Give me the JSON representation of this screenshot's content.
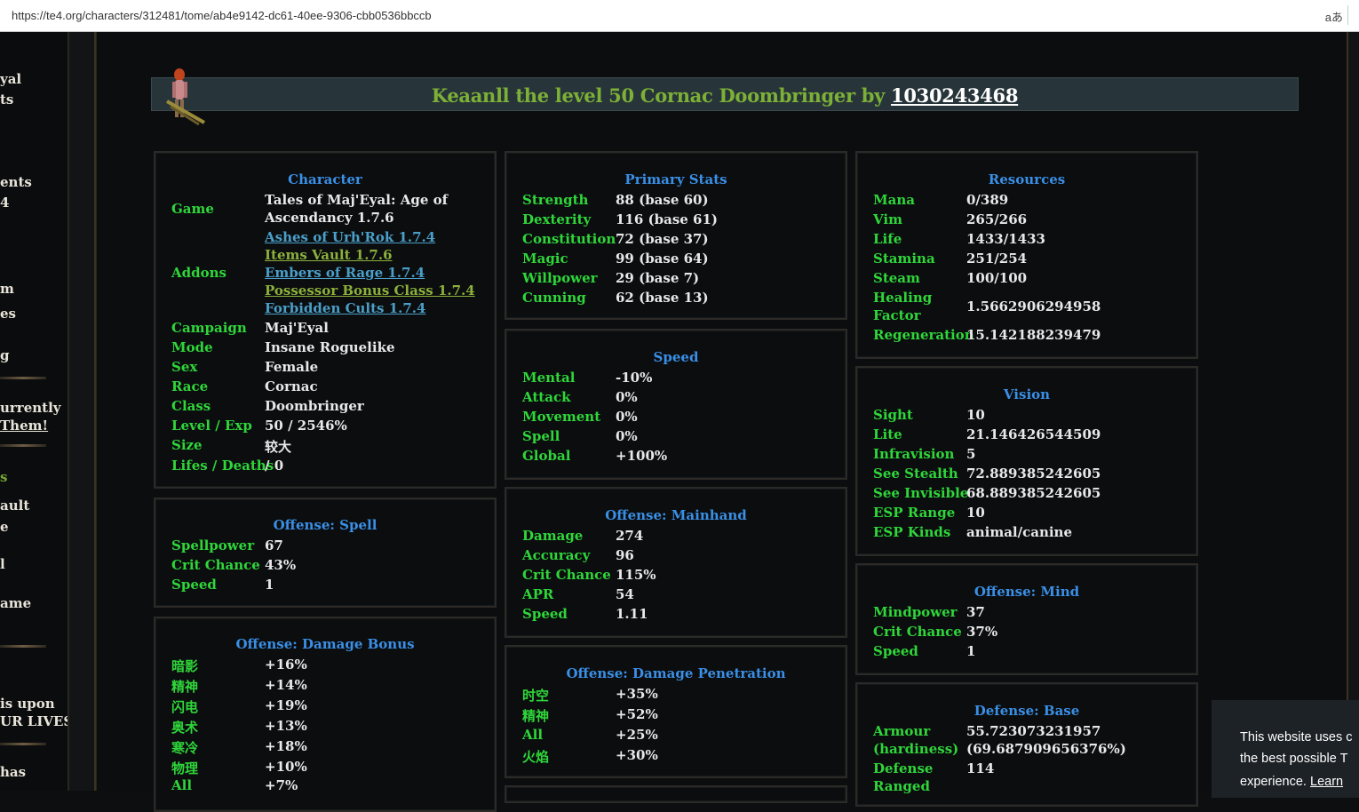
{
  "browser": {
    "url": "https://te4.org/characters/312481/tome/ab4e9142-dc61-40ee-9306-cbb0536bbccb",
    "aa_icon": "aあ"
  },
  "leftnav": {
    "fragments": [
      "yal",
      "ts",
      "ents",
      "4",
      "m",
      "es",
      "g",
      "urrently",
      "Them!",
      "s",
      "ault",
      "e",
      "l",
      "ame",
      "is upon",
      "UR LIVES!",
      "has"
    ]
  },
  "header": {
    "prefix": "Keaanll the level 50 Cornac Doombringer by ",
    "user": "1030243468"
  },
  "character": {
    "title": "Character",
    "game_label": "Game",
    "game_line1": "Tales of Maj'Eyal: Age of",
    "game_line2": "Ascendancy 1.7.6",
    "addons_label": "Addons",
    "addons": [
      "Ashes of Urh'Rok 1.7.4",
      "Items Vault 1.7.6",
      "Embers of Rage 1.7.4",
      "Possessor Bonus Class 1.7.4",
      "Forbidden Cults 1.7.4"
    ],
    "rows": [
      {
        "label": "Campaign",
        "value": "Maj'Eyal"
      },
      {
        "label": "Mode",
        "value": "Insane Roguelike"
      },
      {
        "label": "Sex",
        "value": "Female"
      },
      {
        "label": "Race",
        "value": "Cornac"
      },
      {
        "label": "Class",
        "value": "Doombringer"
      },
      {
        "label": "Level / Exp",
        "value": "50 / 2546%"
      },
      {
        "label": "Size",
        "value": "较大"
      },
      {
        "label": "Lifes / Deaths",
        "value": "/ 0"
      }
    ]
  },
  "offense_spell": {
    "title": "Offense: Spell",
    "rows": [
      {
        "label": "Spellpower",
        "value": "67"
      },
      {
        "label": "Crit Chance",
        "value": "43%"
      },
      {
        "label": "Speed",
        "value": "1"
      }
    ]
  },
  "damage_bonus": {
    "title": "Offense: Damage Bonus",
    "rows": [
      {
        "label": "暗影",
        "value": "+16%"
      },
      {
        "label": "精神",
        "value": "+14%"
      },
      {
        "label": "闪电",
        "value": "+19%"
      },
      {
        "label": "奥术",
        "value": "+13%"
      },
      {
        "label": "寒冷",
        "value": "+18%"
      },
      {
        "label": "物理",
        "value": "+10%"
      },
      {
        "label": "All",
        "value": "+7%"
      }
    ]
  },
  "primary_stats": {
    "title": "Primary Stats",
    "rows": [
      {
        "label": "Strength",
        "value": "88 (base 60)"
      },
      {
        "label": "Dexterity",
        "value": "116 (base 61)"
      },
      {
        "label": "Constitution",
        "value": "72 (base 37)"
      },
      {
        "label": "Magic",
        "value": "99 (base 64)"
      },
      {
        "label": "Willpower",
        "value": "29 (base 7)"
      },
      {
        "label": "Cunning",
        "value": "62 (base 13)"
      }
    ]
  },
  "speed": {
    "title": "Speed",
    "rows": [
      {
        "label": "Mental",
        "value": "-10%"
      },
      {
        "label": "Attack",
        "value": "0%"
      },
      {
        "label": "Movement",
        "value": "0%"
      },
      {
        "label": "Spell",
        "value": "0%"
      },
      {
        "label": "Global",
        "value": "+100%"
      }
    ]
  },
  "mainhand": {
    "title": "Offense: Mainhand",
    "rows": [
      {
        "label": "Damage",
        "value": "274"
      },
      {
        "label": "Accuracy",
        "value": "96"
      },
      {
        "label": "Crit Chance",
        "value": "115%"
      },
      {
        "label": "APR",
        "value": "54"
      },
      {
        "label": "Speed",
        "value": "1.11"
      }
    ]
  },
  "penetration": {
    "title": "Offense: Damage Penetration",
    "rows": [
      {
        "label": "时空",
        "value": "+35%"
      },
      {
        "label": "精神",
        "value": "+52%"
      },
      {
        "label": "All",
        "value": "+25%"
      },
      {
        "label": "火焰",
        "value": "+30%"
      }
    ]
  },
  "resources": {
    "title": "Resources",
    "rows": [
      {
        "label": "Mana",
        "value": "0/389"
      },
      {
        "label": "Vim",
        "value": "265/266"
      },
      {
        "label": "Life",
        "value": "1433/1433"
      },
      {
        "label": "Stamina",
        "value": "251/254"
      },
      {
        "label": "Steam",
        "value": "100/100"
      }
    ],
    "healing_label1": "Healing",
    "healing_label2": "Factor",
    "healing_value": "1.5662906294958",
    "regen_label": "Regeneration",
    "regen_value": "15.142188239479"
  },
  "vision": {
    "title": "Vision",
    "rows": [
      {
        "label": "Sight",
        "value": "10"
      },
      {
        "label": "Lite",
        "value": "21.146426544509"
      },
      {
        "label": "Infravision",
        "value": "5"
      },
      {
        "label": "See Stealth",
        "value": "72.889385242605"
      },
      {
        "label": "See Invisible",
        "value": "68.889385242605"
      },
      {
        "label": "ESP Range",
        "value": "10"
      },
      {
        "label": "ESP Kinds",
        "value": "animal/canine"
      }
    ]
  },
  "offense_mind": {
    "title": "Offense: Mind",
    "rows": [
      {
        "label": "Mindpower",
        "value": "37"
      },
      {
        "label": "Crit Chance",
        "value": "37%"
      },
      {
        "label": "Speed",
        "value": "1"
      }
    ]
  },
  "defense_base": {
    "title": "Defense: Base",
    "armour_label": "Armour",
    "armour_value": "55.723073231957",
    "hardiness_label": "(hardiness)",
    "hardiness_value": "(69.687909656376%)",
    "defense_label": "Defense",
    "defense_value": "114",
    "ranged_label": "Ranged"
  },
  "cookie": {
    "line1": "This website uses c",
    "line2": "the best possible T",
    "line3": "experience.",
    "learn": "Learn"
  }
}
